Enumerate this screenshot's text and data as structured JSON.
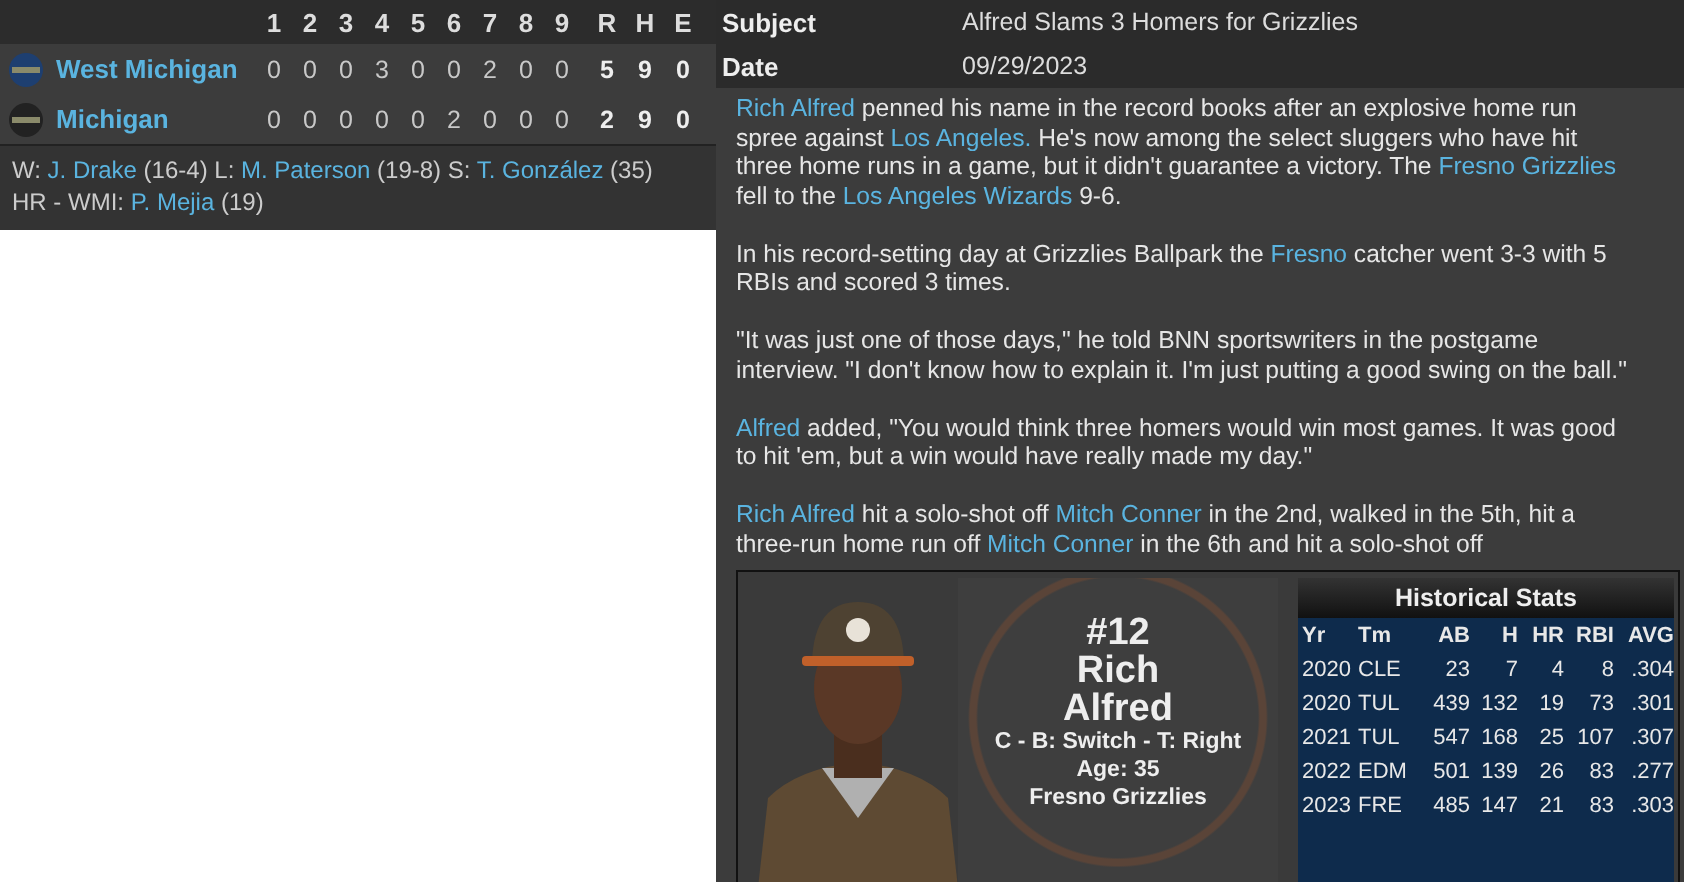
{
  "line_score": {
    "columns": [
      "1",
      "2",
      "3",
      "4",
      "5",
      "6",
      "7",
      "8",
      "9",
      "R",
      "H",
      "E"
    ],
    "teams": [
      {
        "name": "West Michigan",
        "innings": [
          "0",
          "0",
          "0",
          "3",
          "0",
          "0",
          "2",
          "0",
          "0"
        ],
        "totals": [
          "5",
          "9",
          "0"
        ]
      },
      {
        "name": "Michigan",
        "innings": [
          "0",
          "0",
          "0",
          "0",
          "0",
          "2",
          "0",
          "0",
          "0"
        ],
        "totals": [
          "2",
          "9",
          "0"
        ]
      }
    ]
  },
  "summary": [
    [
      {
        "text": "W: ",
        "link": false
      },
      {
        "text": "J. Drake",
        "link": true
      },
      {
        "text": " (16-4) L: ",
        "link": false
      },
      {
        "text": "M. Paterson",
        "link": true
      },
      {
        "text": " (19-8) S: ",
        "link": false
      },
      {
        "text": "T. González",
        "link": true
      },
      {
        "text": " (35)",
        "link": false
      }
    ],
    [
      {
        "text": "HR - WMI: ",
        "link": false
      },
      {
        "text": "P. Mejia",
        "link": true
      },
      {
        "text": " (19)",
        "link": false
      }
    ]
  ],
  "article": {
    "fields": [
      {
        "label": "Subject",
        "value": "Alfred Slams 3 Homers for Grizzlies"
      },
      {
        "label": "Date",
        "value": "09/29/2023"
      }
    ],
    "paragraphs": [
      [
        {
          "text": "Rich Alfred",
          "link": true
        },
        {
          "text": " penned his name in the record books after an explosive home run spree against ",
          "link": false
        },
        {
          "text": "Los Angeles.",
          "link": true
        },
        {
          "text": " He's now among the select sluggers who have hit three home runs in a game, but it didn't guarantee a victory. The ",
          "link": false
        },
        {
          "text": "Fresno Grizzlies",
          "link": true
        },
        {
          "text": " fell to the ",
          "link": false
        },
        {
          "text": "Los Angeles Wizards",
          "link": true
        },
        {
          "text": " 9-6.",
          "link": false
        }
      ],
      [
        {
          "text": "In his record-setting day at Grizzlies Ballpark the ",
          "link": false
        },
        {
          "text": "Fresno",
          "link": true
        },
        {
          "text": " catcher went 3-3 with 5 RBIs and scored 3 times.",
          "link": false
        }
      ],
      [
        {
          "text": "\"It was just one of those days,\" he told BNN sportswriters in the postgame interview. \"I don't know how to explain it. I'm just putting a good swing on the ball.\"",
          "link": false
        }
      ],
      [
        {
          "text": "Alfred",
          "link": true
        },
        {
          "text": " added, \"You would think three homers would win most games. It was good to hit 'em, but a win would have really made my day.\"",
          "link": false
        }
      ],
      [
        {
          "text": "Rich Alfred",
          "link": true
        },
        {
          "text": " hit a solo-shot off ",
          "link": false
        },
        {
          "text": "Mitch Conner",
          "link": true
        },
        {
          "text": " in the 2nd, walked in the 5th, hit a three-run home run off ",
          "link": false
        },
        {
          "text": "Mitch Conner",
          "link": true
        },
        {
          "text": " in the 6th and hit a solo-shot off",
          "link": false
        }
      ]
    ]
  },
  "player_card": {
    "number": "#12",
    "first_name": "Rich",
    "last_name": "Alfred",
    "details": [
      "C - B: Switch - T: Right",
      "Age: 35",
      "Fresno Grizzlies"
    ],
    "stats": {
      "title": "Historical Stats",
      "columns": [
        "Yr",
        "Tm",
        "AB",
        "H",
        "HR",
        "RBI",
        "AVG"
      ],
      "rows": [
        [
          "2020",
          "CLE",
          "23",
          "7",
          "4",
          "8",
          ".304"
        ],
        [
          "2020",
          "TUL",
          "439",
          "132",
          "19",
          "73",
          ".301"
        ],
        [
          "2021",
          "TUL",
          "547",
          "168",
          "25",
          "107",
          ".307"
        ],
        [
          "2022",
          "EDM",
          "501",
          "139",
          "26",
          "83",
          ".277"
        ],
        [
          "2023",
          "FRE",
          "485",
          "147",
          "21",
          "83",
          ".303"
        ]
      ]
    }
  }
}
